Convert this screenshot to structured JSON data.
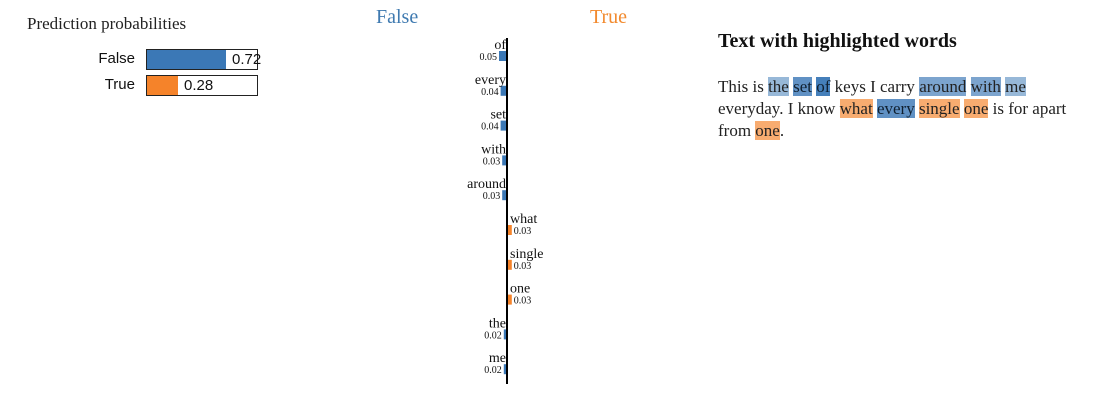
{
  "proba": {
    "title": "Prediction probabilities",
    "items": [
      {
        "label": "False",
        "value": 0.72,
        "display": "0.72",
        "color": "#3b78b6"
      },
      {
        "label": "True",
        "value": 0.28,
        "display": "0.28",
        "color": "#f5832a"
      }
    ]
  },
  "classes": {
    "negative": {
      "label": "False",
      "color": "#3f7ab0"
    },
    "positive": {
      "label": "True",
      "color": "#f28a2e"
    }
  },
  "chart_data": {
    "type": "bar",
    "orientation": "horizontal",
    "categories": [
      "of",
      "every",
      "set",
      "with",
      "around",
      "what",
      "single",
      "one",
      "the",
      "me"
    ],
    "values": [
      -0.05,
      -0.04,
      -0.04,
      -0.03,
      -0.03,
      0.03,
      0.03,
      0.03,
      -0.02,
      -0.02
    ],
    "labels": [
      "0.05",
      "0.04",
      "0.04",
      "0.03",
      "0.03",
      "0.03",
      "0.03",
      "0.03",
      "0.02",
      "0.02"
    ],
    "negative_label": "False",
    "positive_label": "True",
    "negative_color": "#3b78b6",
    "positive_color": "#f5832a"
  },
  "text_panel": {
    "title": "Text with highlighted words",
    "tokens": [
      {
        "t": "This",
        "w": 0
      },
      {
        "t": " "
      },
      {
        "t": "is",
        "w": 0
      },
      {
        "t": " "
      },
      {
        "t": "the",
        "w": -0.02
      },
      {
        "t": " "
      },
      {
        "t": "set",
        "w": -0.04
      },
      {
        "t": " "
      },
      {
        "t": "of",
        "w": -0.05
      },
      {
        "t": " "
      },
      {
        "t": "keys",
        "w": 0
      },
      {
        "t": " "
      },
      {
        "t": "I",
        "w": 0
      },
      {
        "t": " "
      },
      {
        "t": "carry",
        "w": 0
      },
      {
        "t": " "
      },
      {
        "t": "around",
        "w": -0.03
      },
      {
        "t": " "
      },
      {
        "t": "with",
        "w": -0.03
      },
      {
        "t": " "
      },
      {
        "t": "me",
        "w": -0.02
      },
      {
        "t": " "
      },
      {
        "t": "everyday.",
        "w": 0
      },
      {
        "t": " "
      },
      {
        "t": "I",
        "w": 0
      },
      {
        "t": " "
      },
      {
        "t": "know",
        "w": 0
      },
      {
        "t": " "
      },
      {
        "t": "what",
        "w": 0.03
      },
      {
        "t": " "
      },
      {
        "t": "every",
        "w": -0.04
      },
      {
        "t": " "
      },
      {
        "t": "single",
        "w": 0.03
      },
      {
        "t": " "
      },
      {
        "t": "one",
        "w": 0.03
      },
      {
        "t": " "
      },
      {
        "t": "is",
        "w": 0
      },
      {
        "t": " "
      },
      {
        "t": "for",
        "w": 0
      },
      {
        "t": " "
      },
      {
        "t": "apart",
        "w": 0
      },
      {
        "t": " "
      },
      {
        "t": "from",
        "w": 0
      },
      {
        "t": " "
      },
      {
        "t": "one",
        "w": 0.03
      },
      {
        "t": ".",
        "w": 0
      }
    ]
  }
}
